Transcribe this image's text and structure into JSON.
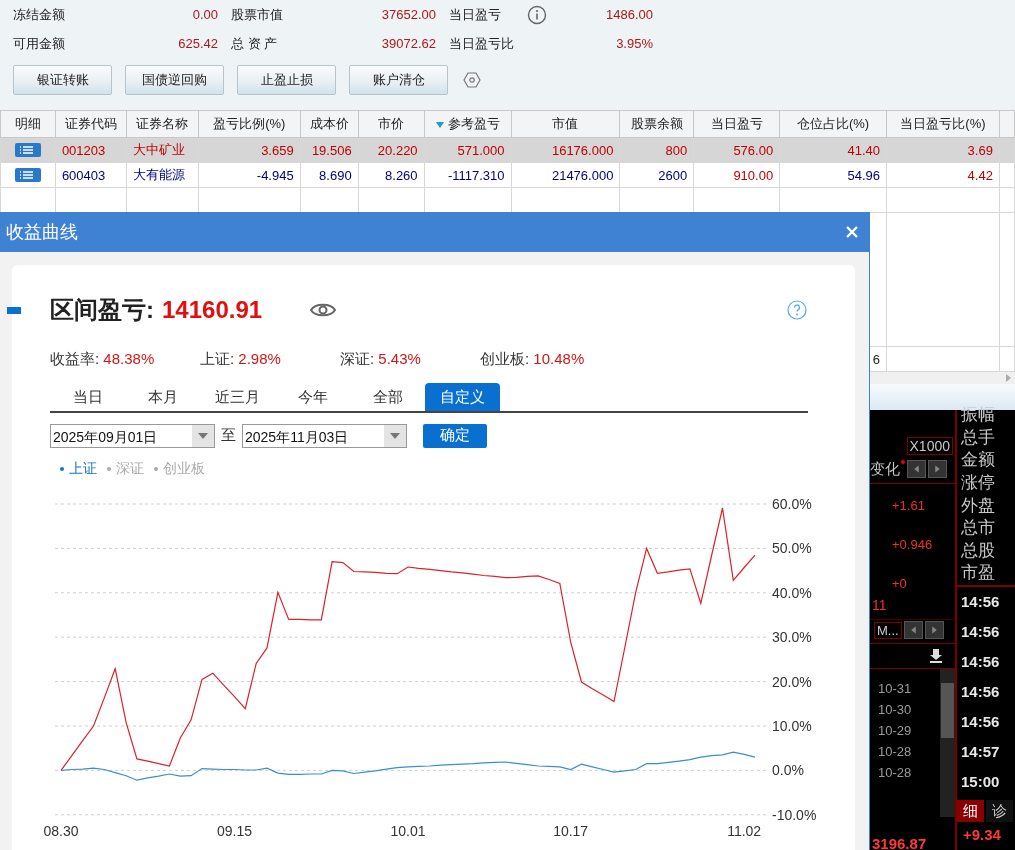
{
  "account": {
    "items": [
      {
        "label": "冻结金额",
        "value": "0.00",
        "has_info": false
      },
      {
        "label": "股票市值",
        "value": "37652.00",
        "has_info": false
      },
      {
        "label": "当日盈亏",
        "value": "1486.00",
        "has_info": true
      },
      {
        "label": "可用金额",
        "value": "625.42",
        "has_info": false
      },
      {
        "label": "总 资 产",
        "value": "39072.62",
        "has_info": false
      },
      {
        "label": "当日盈亏比",
        "value": "3.95%",
        "has_info": false
      }
    ]
  },
  "buttons": [
    "银证转账",
    "国债逆回购",
    "止盈止损",
    "账户清仓"
  ],
  "table": {
    "columns": [
      {
        "label": "明细",
        "sorted": false
      },
      {
        "label": "证券代码",
        "sorted": false
      },
      {
        "label": "证券名称",
        "sorted": false
      },
      {
        "label": "盈亏比例(%)",
        "sorted": false
      },
      {
        "label": "成本价",
        "sorted": false
      },
      {
        "label": "市价",
        "sorted": false
      },
      {
        "label": "参考盈亏",
        "sorted": true
      },
      {
        "label": "市值",
        "sorted": false
      },
      {
        "label": "股票余额",
        "sorted": false
      },
      {
        "label": "当日盈亏",
        "sorted": false
      },
      {
        "label": "仓位占比(%)",
        "sorted": false
      },
      {
        "label": "当日盈亏比(%)",
        "sorted": false
      }
    ],
    "rows": [
      {
        "selected": true,
        "cells": [
          {
            "text": ""
          },
          {
            "text": "001203",
            "up": true
          },
          {
            "text": "大中矿业",
            "up": true
          },
          {
            "text": "3.659",
            "up": true
          },
          {
            "text": "19.506",
            "up": true
          },
          {
            "text": "20.220",
            "up": true
          },
          {
            "text": "571.000",
            "up": true
          },
          {
            "text": "16176.000",
            "up": true
          },
          {
            "text": "800",
            "up": true
          },
          {
            "text": "576.00",
            "up": true
          },
          {
            "text": "41.40",
            "up": true
          },
          {
            "text": "3.69",
            "up": true
          }
        ]
      },
      {
        "selected": false,
        "cells": [
          {
            "text": ""
          },
          {
            "text": "600403",
            "up": false
          },
          {
            "text": "大有能源",
            "up": false
          },
          {
            "text": "-4.945",
            "up": false
          },
          {
            "text": "8.690",
            "up": false
          },
          {
            "text": "8.260",
            "up": false
          },
          {
            "text": "-1117.310",
            "up": false
          },
          {
            "text": "21476.000",
            "up": false
          },
          {
            "text": "2600",
            "up": false
          },
          {
            "text": "910.00",
            "up": true
          },
          {
            "text": "54.96",
            "up": false
          },
          {
            "text": "4.42",
            "up": true
          }
        ]
      }
    ],
    "total_fragment": "6"
  },
  "dialog": {
    "title": "收益曲线",
    "heading_label": "区间盈亏:",
    "heading_value": "14160.91",
    "stats": [
      {
        "label": "收益率:",
        "value": "48.38%"
      },
      {
        "label": "上证:",
        "value": "2.98%"
      },
      {
        "label": "深证:",
        "value": "5.43%"
      },
      {
        "label": "创业板:",
        "value": "10.48%"
      }
    ],
    "tabs": [
      {
        "label": "当日",
        "selected": false
      },
      {
        "label": "本月",
        "selected": false
      },
      {
        "label": "近三月",
        "selected": false
      },
      {
        "label": "今年",
        "selected": false
      },
      {
        "label": "全部",
        "selected": false
      },
      {
        "label": "自定义",
        "selected": true
      }
    ],
    "date_from": "2025年09月01日",
    "range_separator": "至",
    "date_to": "2025年11月03日",
    "confirm": "确定",
    "legend": [
      {
        "label": "上证",
        "selected": true
      },
      {
        "label": "深证",
        "selected": false
      },
      {
        "label": "创业板",
        "selected": false
      }
    ],
    "chart_data": {
      "type": "line",
      "categories": [
        "08.30",
        null,
        null,
        null,
        null,
        null,
        null,
        null,
        null,
        null,
        null,
        null,
        null,
        null,
        null,
        null,
        "09.15",
        null,
        null,
        null,
        null,
        null,
        null,
        null,
        null,
        null,
        null,
        null,
        null,
        null,
        null,
        null,
        "10.01",
        null,
        null,
        null,
        null,
        null,
        null,
        null,
        null,
        null,
        null,
        null,
        null,
        null,
        null,
        "10.17",
        null,
        null,
        null,
        null,
        null,
        null,
        null,
        null,
        null,
        null,
        null,
        null,
        null,
        null,
        null,
        "11.02",
        null
      ],
      "series": [
        {
          "color": "#d9232b",
          "values": [
            0,
            3.3,
            6.7,
            10,
            16.4,
            22.9,
            10.8,
            2.6,
            2.1,
            1.5,
            1,
            7.3,
            11.4,
            20.5,
            21.9,
            19.2,
            16.6,
            13.9,
            24.1,
            27.6,
            40.1,
            34,
            34,
            33.9,
            33.9,
            47,
            46.8,
            44.8,
            44.7,
            44.6,
            44.4,
            44.3,
            45.8,
            45.5,
            45.3,
            45,
            44.7,
            44.5,
            44.2,
            43.9,
            43.7,
            43.4,
            43.5,
            43.7,
            43.8,
            43,
            42.1,
            28.9,
            19.9,
            18.4,
            17,
            15.5,
            27.8,
            40.1,
            50,
            44.4,
            44.7,
            45.1,
            45.4,
            37.6,
            48.4,
            59.1,
            42.8,
            45.7,
            48.5
          ]
        },
        {
          "color": "#3a8ed0",
          "values": [
            0,
            0.2,
            0.3,
            0.5,
            0.2,
            -0.5,
            -1.2,
            -2.2,
            -1.7,
            -1.3,
            -0.8,
            -1.3,
            -1.2,
            0.4,
            0.3,
            0.2,
            0.2,
            0.1,
            0.1,
            0.5,
            -0.6,
            -0.9,
            -0.9,
            -0.8,
            -0.8,
            0,
            -0.1,
            -0.7,
            -0.4,
            -0.1,
            0.3,
            0.6,
            0.8,
            0.9,
            1.0,
            1.2,
            1.3,
            1.4,
            1.5,
            1.7,
            1.8,
            1.9,
            1.6,
            1.3,
            1.0,
            0.9,
            0.8,
            0.2,
            1.4,
            0.8,
            0.2,
            -0.4,
            -0.1,
            0.2,
            1.5,
            1.5,
            1.8,
            2.1,
            2.4,
            3.0,
            3.3,
            3.5,
            4.1,
            3.6,
            3.0
          ]
        }
      ],
      "ylim": [
        -10,
        60
      ],
      "yticks": [
        {
          "value": 60,
          "label": "60.0%"
        },
        {
          "value": 50,
          "label": "50.0%"
        },
        {
          "value": 40,
          "label": "40.0%"
        },
        {
          "value": 30,
          "label": "30.0%"
        },
        {
          "value": 20,
          "label": "20.0%"
        },
        {
          "value": 10,
          "label": "10.0%"
        },
        {
          "value": 0,
          "label": "0.0%"
        },
        {
          "value": -10,
          "label": "-10.0%"
        }
      ],
      "grid": true
    }
  },
  "quote_panel": {
    "multiplier": "X1000",
    "change_label": "变化",
    "scale_labels": [
      "+1.61",
      "+0.946",
      "+0"
    ],
    "mark": "11",
    "menu_label": "M...",
    "dates": [
      "10-31",
      "10-30",
      "10-29",
      "10-28",
      "10-28"
    ],
    "index_value": "3196.87",
    "fields": [
      "振幅",
      "总手",
      "金额",
      "涨停",
      "外盘",
      "总市",
      "总股",
      "市盈"
    ],
    "times": [
      "14:56",
      "14:56",
      "14:56",
      "14:56",
      "14:56",
      "14:57",
      "15:00"
    ],
    "tabs": [
      {
        "label": "细",
        "selected": true
      },
      {
        "label": "诊",
        "selected": false
      }
    ],
    "index_change": "+9.34"
  }
}
